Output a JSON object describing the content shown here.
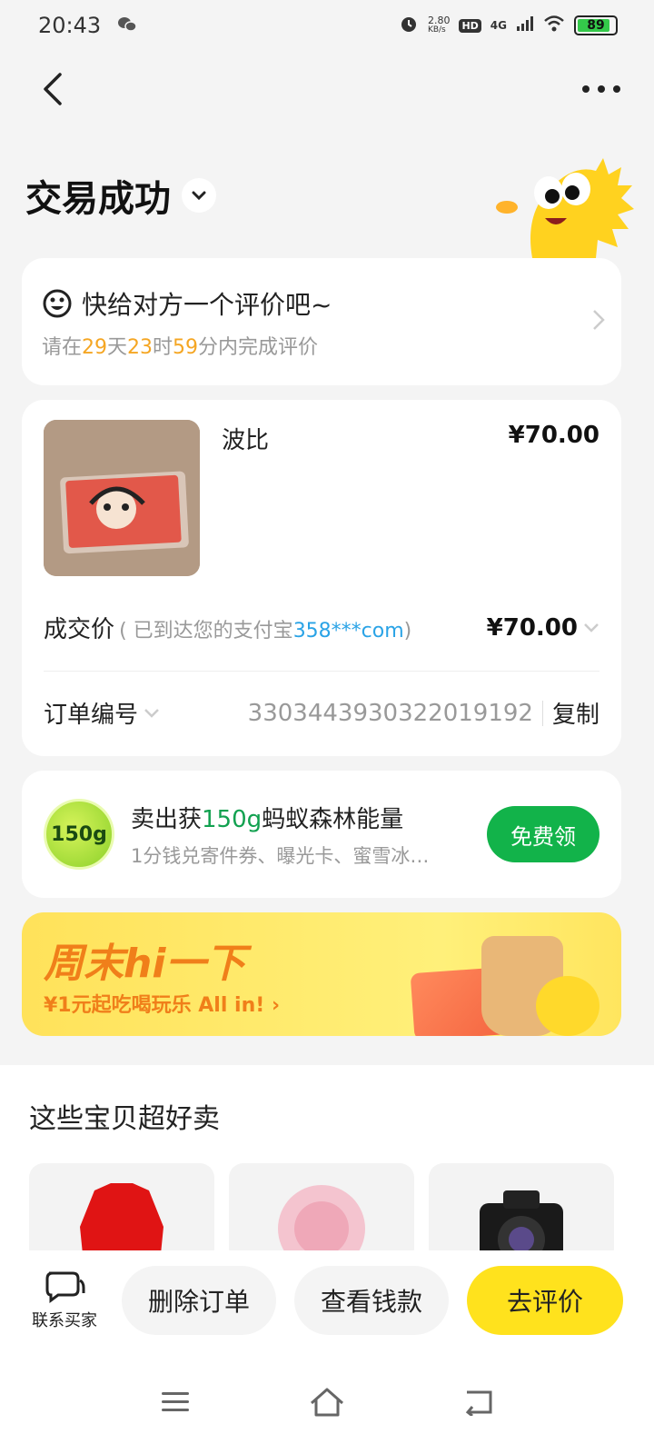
{
  "status_bar": {
    "time": "20:43",
    "net_speed": "2.80",
    "net_unit": "KB/s",
    "hd": "HD",
    "signal": "4G",
    "battery": "89"
  },
  "page": {
    "title": "交易成功"
  },
  "review": {
    "title": "快给对方一个评价吧~",
    "prefix": "请在",
    "days": "29",
    "days_unit": "天",
    "hours": "23",
    "hours_unit": "时",
    "minutes": "59",
    "suffix": "分内完成评价"
  },
  "order": {
    "item_name": "波比",
    "item_price": "¥70.00",
    "deal_label": "成交价",
    "deal_note_prefix": "( 已到达您的支付宝",
    "deal_account": "358***com",
    "deal_note_suffix": ")",
    "deal_price": "¥70.00",
    "order_no_label": "订单编号",
    "order_no": "3303443930322019192",
    "copy_label": "复制"
  },
  "energy": {
    "badge": "150g",
    "title_prefix": "卖出获",
    "title_amount": "150g",
    "title_suffix": "蚂蚁森林能量",
    "subtitle": "1分钱兑寄件券、曝光卡、蜜雪冰…",
    "button": "免费领"
  },
  "promo": {
    "title": "周末hi一下",
    "subtitle": "¥1元起吃喝玩乐 All in!  ›"
  },
  "recommendations": {
    "title": "这些宝贝超好卖"
  },
  "bottom_bar": {
    "contact": "联系买家",
    "delete": "删除订单",
    "view_money": "查看钱款",
    "review": "去评价"
  },
  "colors": {
    "accent_yellow": "#ffe21d",
    "highlight_orange": "#f5a623",
    "energy_green": "#12a150",
    "account_blue": "#2aa3e6"
  }
}
